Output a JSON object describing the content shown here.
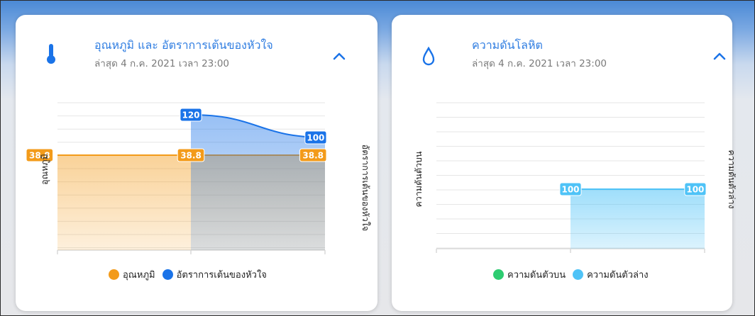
{
  "cards": [
    {
      "title": "อุณหภูมิ และ อัตราการเต้นของหัวใจ",
      "subtitle": "ล่าสุด 4 ก.ค. 2021 เวลา 23:00",
      "icon": "thermometer-icon",
      "legend": [
        {
          "label": "อุณหภูมิ",
          "color": "#f39b1a"
        },
        {
          "label": "อัตราการเต้นของหัวใจ",
          "color": "#1a73e8"
        }
      ]
    },
    {
      "title": "ความดันโลหิต",
      "subtitle": "ล่าสุด 4 ก.ค. 2021 เวลา 23:00",
      "icon": "water-drop-icon",
      "legend": [
        {
          "label": "ความดันตัวบน",
          "color": "#2ecc71"
        },
        {
          "label": "ความดันตัวล่าง",
          "color": "#4fc3f7"
        }
      ]
    }
  ],
  "chart_data": [
    {
      "type": "area",
      "title": "",
      "x": [
        0,
        1,
        2
      ],
      "ylabel_left": "อุณหภูมิ",
      "ylabel_right": "อัตราการเต้นของหัวใจ",
      "grid": true,
      "legend_position": "bottom",
      "series": [
        {
          "name": "อุณหภูมิ",
          "axis": "left",
          "values": [
            38.8,
            38.8,
            38.8
          ],
          "color": "#f39b1a"
        },
        {
          "name": "อัตราการเต้นของหัวใจ",
          "axis": "right",
          "values": [
            null,
            120,
            100
          ],
          "color": "#1a73e8"
        }
      ]
    },
    {
      "type": "area",
      "title": "",
      "x": [
        0,
        1,
        2
      ],
      "ylabel_left": "ความดันตัวบน",
      "ylabel_right": "ความดันตัวล่าง",
      "grid": true,
      "legend_position": "bottom",
      "series": [
        {
          "name": "ความดันตัวบน",
          "axis": "left",
          "values": [
            null,
            null,
            null
          ],
          "color": "#2ecc71"
        },
        {
          "name": "ความดันตัวล่าง",
          "axis": "right",
          "values": [
            null,
            100,
            100
          ],
          "color": "#4fc3f7"
        }
      ]
    }
  ]
}
